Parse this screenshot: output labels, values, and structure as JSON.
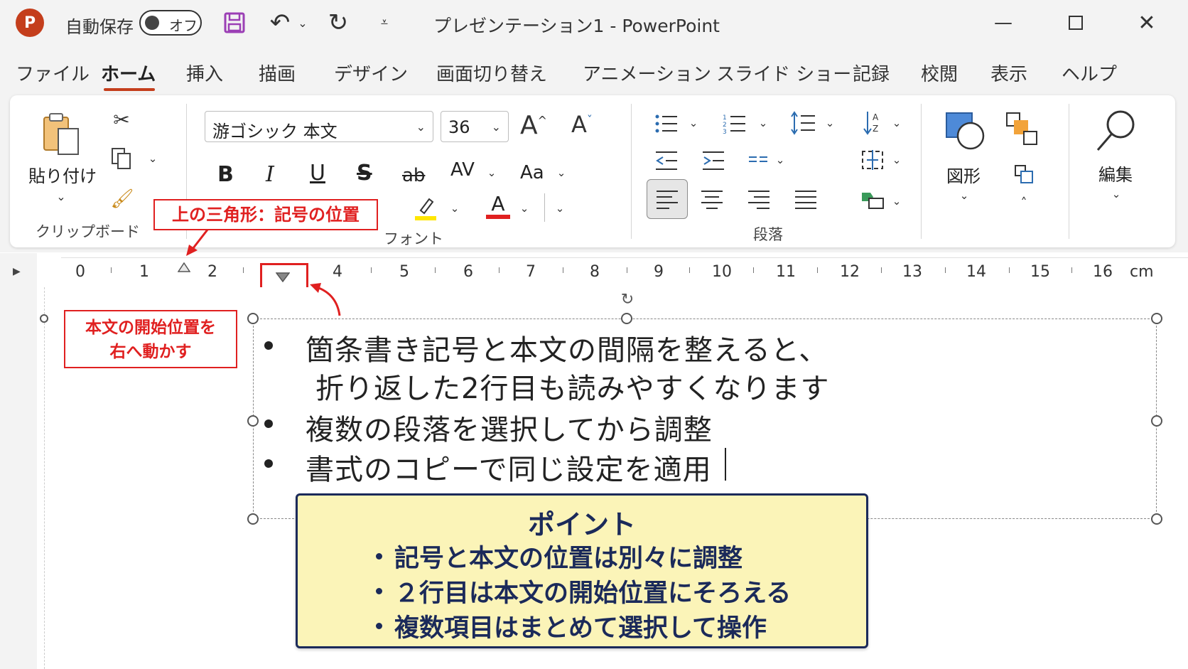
{
  "titlebar": {
    "autosave_label": "自動保存",
    "autosave_state": "オフ",
    "title": "プレゼンテーション1  -  PowerPoint"
  },
  "menu": [
    "ファイル",
    "ホーム",
    "挿入",
    "描画",
    "デザイン",
    "画面切り替え",
    "アニメーション",
    "スライド ショー",
    "記録",
    "校閲",
    "表示",
    "ヘルプ"
  ],
  "ribbon": {
    "paste_label": "貼り付け",
    "clipboard_label": "クリップボード",
    "font_name": "游ゴシック 本文",
    "font_size": "36",
    "font_label": "フォント",
    "paragraph_label": "段落",
    "shapes_label": "図形",
    "edit_label": "編集",
    "bold": "B",
    "italic": "I",
    "underline": "U",
    "strike": "S",
    "ab": "ab",
    "av": "AV",
    "aa": "Aa",
    "fontcolor": "A",
    "grow": "A",
    "shrink": "A"
  },
  "ruler": {
    "numbers": [
      "0",
      "1",
      "2",
      "4",
      "5",
      "6",
      "7",
      "8",
      "9",
      "10",
      "11",
      "12",
      "13",
      "14",
      "15",
      "16"
    ],
    "unit": "cm"
  },
  "callouts": {
    "top_marker": "上の三角形：記号の位置",
    "body_start_line1": "本文の開始位置を",
    "body_start_line2": "右へ動かす"
  },
  "slide": {
    "lines": [
      "箇条書き記号と本文の間隔を整えると、",
      "折り返した2行目も読みやすくなります",
      "複数の段落を選択してから調整",
      "書式のコピーで同じ設定を適用"
    ]
  },
  "point": {
    "title": "ポイント",
    "items": [
      "記号と本文の位置は別々に調整",
      "２行目は本文の開始位置にそろえる",
      "複数項目はまとめて選択して操作"
    ]
  },
  "colors": {
    "accent": "#c43e1c",
    "callout_red": "#e02020",
    "point_bg": "#fbf4b8",
    "point_border": "#1b2a5a"
  }
}
